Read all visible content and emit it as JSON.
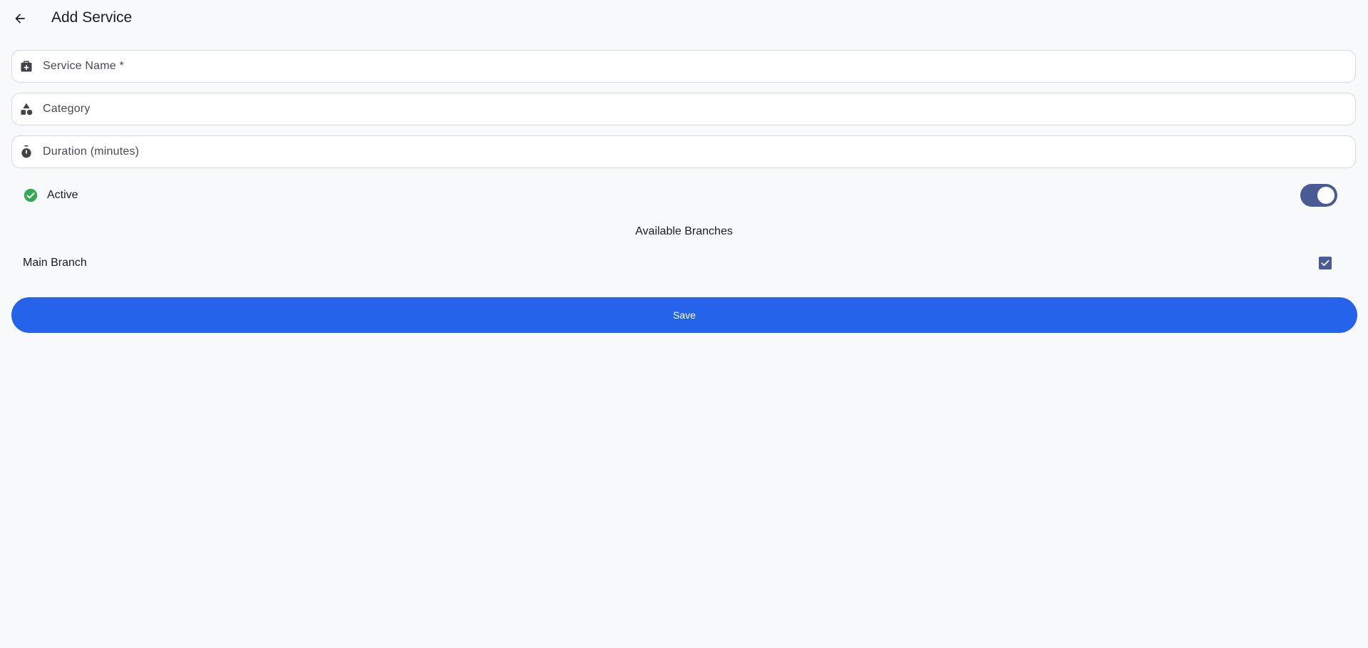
{
  "header": {
    "title": "Add Service",
    "back_icon": "arrow-back-icon"
  },
  "form": {
    "fields": [
      {
        "icon": "medical-bag-icon",
        "placeholder": "Service Name *",
        "value": ""
      },
      {
        "icon": "category-shapes-icon",
        "placeholder": "Category",
        "value": ""
      },
      {
        "icon": "timer-icon",
        "placeholder": "Duration (minutes)",
        "value": ""
      }
    ],
    "active": {
      "icon": "check-circle-icon",
      "label": "Active",
      "enabled": true
    }
  },
  "branches": {
    "title": "Available Branches",
    "items": [
      {
        "label": "Main Branch",
        "checked": true
      }
    ]
  },
  "actions": {
    "save_label": "Save"
  },
  "colors": {
    "background": "#f8f9fb",
    "primary_button": "#2563eb",
    "toggle_and_checkbox": "#4a5a94",
    "active_icon": "#34a853",
    "field_icon": "#424248"
  }
}
